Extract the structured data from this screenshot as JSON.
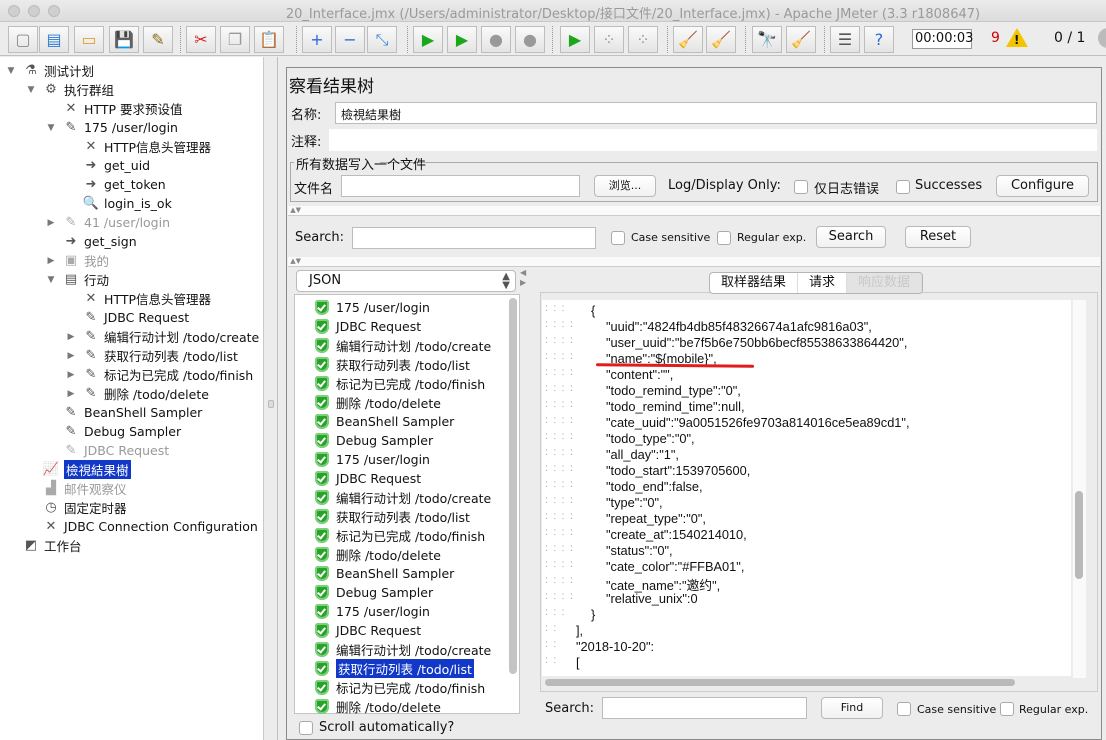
{
  "window": {
    "title": "20_Interface.jmx (/Users/administrator/Desktop/接口文件/20_Interface.jmx) - Apache JMeter (3.3 r1808647)"
  },
  "toolbar": {
    "buttons": [
      {
        "name": "new-icon",
        "glyph": "▢"
      },
      {
        "name": "templates-icon",
        "glyph": "▤"
      },
      {
        "name": "open-icon",
        "glyph": "▭"
      },
      {
        "name": "save-icon",
        "glyph": "💾"
      },
      {
        "name": "save-as-icon",
        "glyph": "✎"
      },
      {
        "name": "cut-icon",
        "glyph": "✂"
      },
      {
        "name": "copy-icon",
        "glyph": "❐"
      },
      {
        "name": "paste-icon",
        "glyph": "📋"
      },
      {
        "name": "expand-icon",
        "glyph": "+"
      },
      {
        "name": "collapse-icon",
        "glyph": "−"
      },
      {
        "name": "toggle-icon",
        "glyph": "⤡"
      },
      {
        "name": "start-icon",
        "glyph": "▶"
      },
      {
        "name": "start-no-pause-icon",
        "glyph": "▶"
      },
      {
        "name": "stop-icon",
        "glyph": "●"
      },
      {
        "name": "shutdown-icon",
        "glyph": "●"
      },
      {
        "name": "remote-start-icon",
        "glyph": "▶"
      },
      {
        "name": "remote-stop-icon",
        "glyph": "⁘"
      },
      {
        "name": "remote-shutdown-icon",
        "glyph": "⁘"
      },
      {
        "name": "clear-icon",
        "glyph": "🧹"
      },
      {
        "name": "clear-all-icon",
        "glyph": "🧹"
      },
      {
        "name": "search-icon",
        "glyph": "🔭"
      },
      {
        "name": "reset-search-icon",
        "glyph": "🧹"
      },
      {
        "name": "function-helper-icon",
        "glyph": "☰"
      },
      {
        "name": "help-icon",
        "glyph": "?"
      }
    ],
    "timer": "00:00:03",
    "error_count": "9",
    "warning_glyph": "!",
    "threads": "0 / 1"
  },
  "tree": {
    "nodes": [
      {
        "label": "测试计划",
        "level": 0,
        "arrow": "▼",
        "icon": "flask-icon",
        "glyph": "⚗",
        "state": "normal"
      },
      {
        "label": "执行群组",
        "level": 1,
        "arrow": "▼",
        "icon": "gear-icon",
        "glyph": "⚙",
        "state": "normal"
      },
      {
        "label": "HTTP 要求预设值",
        "level": 2,
        "arrow": "",
        "icon": "wrench-icon",
        "glyph": "✕",
        "state": "normal"
      },
      {
        "label": "175 /user/login",
        "level": 2,
        "arrow": "▼",
        "icon": "sampler-pipette-icon",
        "glyph": "✎",
        "state": "normal"
      },
      {
        "label": "HTTP信息头管理器",
        "level": 3,
        "arrow": "",
        "icon": "wrench-icon",
        "glyph": "✕",
        "state": "normal"
      },
      {
        "label": "get_uid",
        "level": 3,
        "arrow": "",
        "icon": "extractor-arrow-icon",
        "glyph": "➜",
        "state": "normal"
      },
      {
        "label": "get_token",
        "level": 3,
        "arrow": "",
        "icon": "extractor-arrow-icon",
        "glyph": "➜",
        "state": "normal"
      },
      {
        "label": "login_is_ok",
        "level": 3,
        "arrow": "",
        "icon": "assertion-magnifier-icon",
        "glyph": "🔍",
        "state": "normal"
      },
      {
        "label": "41 /user/login",
        "level": 2,
        "arrow": "▶",
        "icon": "sampler-pipette-icon",
        "glyph": "✎",
        "state": "disabled"
      },
      {
        "label": "get_sign",
        "level": 2,
        "arrow": "",
        "icon": "preprocessor-icon",
        "glyph": "➜",
        "state": "normal"
      },
      {
        "label": "我的",
        "level": 2,
        "arrow": "▶",
        "icon": "controller-icon",
        "glyph": "▣",
        "state": "disabled"
      },
      {
        "label": "行动",
        "level": 2,
        "arrow": "▼",
        "icon": "controller-icon",
        "glyph": "▤",
        "state": "normal"
      },
      {
        "label": "HTTP信息头管理器",
        "level": 3,
        "arrow": "",
        "icon": "wrench-icon",
        "glyph": "✕",
        "state": "normal"
      },
      {
        "label": "JDBC Request",
        "level": 3,
        "arrow": "",
        "icon": "sampler-pipette-icon",
        "glyph": "✎",
        "state": "normal"
      },
      {
        "label": "编辑行动计划 /todo/create",
        "level": 3,
        "arrow": "▶",
        "icon": "sampler-pipette-icon",
        "glyph": "✎",
        "state": "normal"
      },
      {
        "label": "获取行动列表 /todo/list",
        "level": 3,
        "arrow": "▶",
        "icon": "sampler-pipette-icon",
        "glyph": "✎",
        "state": "normal"
      },
      {
        "label": "标记为已完成 /todo/finish",
        "level": 3,
        "arrow": "▶",
        "icon": "sampler-pipette-icon",
        "glyph": "✎",
        "state": "normal"
      },
      {
        "label": "删除 /todo/delete",
        "level": 3,
        "arrow": "▶",
        "icon": "sampler-pipette-icon",
        "glyph": "✎",
        "state": "normal"
      },
      {
        "label": "BeanShell Sampler",
        "level": 2,
        "arrow": "",
        "icon": "sampler-pipette-icon",
        "glyph": "✎",
        "state": "normal"
      },
      {
        "label": "Debug Sampler",
        "level": 2,
        "arrow": "",
        "icon": "sampler-pipette-icon",
        "glyph": "✎",
        "state": "normal"
      },
      {
        "label": "JDBC Request",
        "level": 2,
        "arrow": "",
        "icon": "sampler-pipette-icon",
        "glyph": "✎",
        "state": "disabled"
      },
      {
        "label": "檢視結果樹",
        "level": 1,
        "arrow": "",
        "icon": "listener-graph-icon",
        "glyph": "📈",
        "state": "selected"
      },
      {
        "label": "邮件观察仪",
        "level": 1,
        "arrow": "",
        "icon": "listener-mail-icon",
        "glyph": "▟",
        "state": "disabled"
      },
      {
        "label": "固定定时器",
        "level": 1,
        "arrow": "",
        "icon": "timer-clock-icon",
        "glyph": "◷",
        "state": "normal"
      },
      {
        "label": "JDBC Connection Configuration",
        "level": 1,
        "arrow": "",
        "icon": "wrench-icon",
        "glyph": "✕",
        "state": "normal"
      },
      {
        "label": "工作台",
        "level": 0,
        "arrow": "",
        "icon": "workbench-icon",
        "glyph": "◩",
        "state": "normal"
      }
    ]
  },
  "panel": {
    "title": "察看结果树",
    "name_label": "名称:",
    "name_value": "檢視結果樹",
    "comment_label": "注释:",
    "comment_value": "",
    "file_group_title": "所有数据写入一个文件",
    "filename_label": "文件名",
    "filename_value": "",
    "browse_label": "浏览...",
    "log_display_label": "Log/Display Only:",
    "errors_only_label": "仅日志错误",
    "successes_label": "Successes",
    "configure_label": "Configure"
  },
  "search": {
    "label": "Search:",
    "value": "",
    "case_sensitive_label": "Case sensitive",
    "regex_label": "Regular exp.",
    "search_button": "Search",
    "reset_button": "Reset"
  },
  "renderer": {
    "selected": "JSON"
  },
  "results": {
    "items": [
      "175 /user/login",
      "JDBC Request",
      "编辑行动计划 /todo/create",
      "获取行动列表 /todo/list",
      "标记为已完成 /todo/finish",
      "删除 /todo/delete",
      "BeanShell Sampler",
      "Debug Sampler",
      "175 /user/login",
      "JDBC Request",
      "编辑行动计划 /todo/create",
      "获取行动列表 /todo/list",
      "标记为已完成 /todo/finish",
      "删除 /todo/delete",
      "BeanShell Sampler",
      "Debug Sampler",
      "175 /user/login",
      "JDBC Request",
      "编辑行动计划 /todo/create",
      "获取行动列表 /todo/list",
      "标记为已完成 /todo/finish",
      "删除 /todo/delete"
    ],
    "selected_index": 19,
    "scroll_auto_label": "Scroll automatically?"
  },
  "detail_tabs": [
    {
      "label": "取样器结果",
      "active": false
    },
    {
      "label": "请求",
      "active": false
    },
    {
      "label": "响应数据",
      "active": true
    }
  ],
  "response": {
    "lines": [
      {
        "gutter": ":  :  :",
        "text": "{"
      },
      {
        "gutter": ":  :  :  :",
        "text": "\"uuid\":\"4824fb4db85f48326674a1afc9816a03\","
      },
      {
        "gutter": ":  :  :  :",
        "text": "\"user_uuid\":\"be7f5b6e750bb6becf85538633864420\","
      },
      {
        "gutter": ":  :  :  :",
        "text": "\"name\":\"${mobile}\","
      },
      {
        "gutter": ":  :  :  :",
        "text": "\"content\":\"\","
      },
      {
        "gutter": ":  :  :  :",
        "text": "\"todo_remind_type\":\"0\","
      },
      {
        "gutter": ":  :  :  :",
        "text": "\"todo_remind_time\":null,"
      },
      {
        "gutter": ":  :  :  :",
        "text": "\"cate_uuid\":\"9a0051526fe9703a814016ce5ea89cd1\","
      },
      {
        "gutter": ":  :  :  :",
        "text": "\"todo_type\":\"0\","
      },
      {
        "gutter": ":  :  :  :",
        "text": "\"all_day\":\"1\","
      },
      {
        "gutter": ":  :  :  :",
        "text": "\"todo_start\":1539705600,"
      },
      {
        "gutter": ":  :  :  :",
        "text": "\"todo_end\":false,"
      },
      {
        "gutter": ":  :  :  :",
        "text": "\"type\":\"0\","
      },
      {
        "gutter": ":  :  :  :",
        "text": "\"repeat_type\":\"0\","
      },
      {
        "gutter": ":  :  :  :",
        "text": "\"create_at\":1540214010,"
      },
      {
        "gutter": ":  :  :  :",
        "text": "\"status\":\"0\","
      },
      {
        "gutter": ":  :  :  :",
        "text": "\"cate_color\":\"#FFBA01\","
      },
      {
        "gutter": ":  :  :  :",
        "text": "\"cate_name\":\"邀约\","
      },
      {
        "gutter": ":  :  :  :",
        "text": "\"relative_unix\":0"
      },
      {
        "gutter": ":  :  :",
        "text": "}"
      },
      {
        "gutter": ":  :",
        "text": "],"
      },
      {
        "gutter": ":  :",
        "text": "\"2018-10-20\":"
      },
      {
        "gutter": ":  :",
        "text": "["
      }
    ],
    "highlight_color": "#e31b1b"
  },
  "find": {
    "label": "Search:",
    "value": "",
    "find_button": "Find",
    "case_sensitive_label": "Case sensitive",
    "regex_label": "Regular exp."
  }
}
